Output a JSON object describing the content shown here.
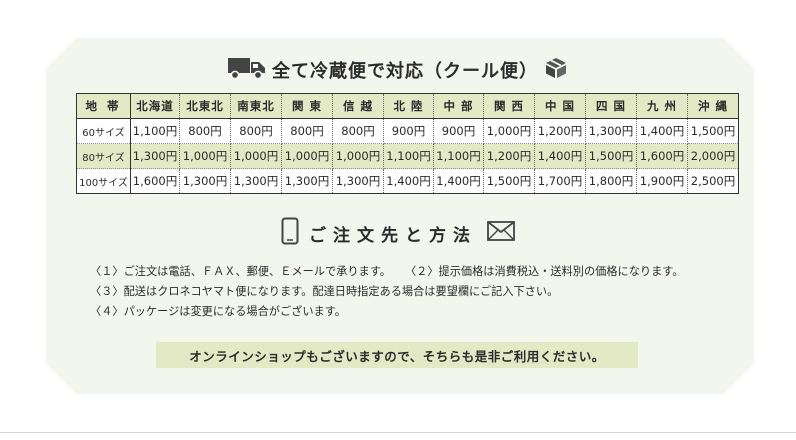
{
  "section1": {
    "title": "全て冷蔵便で対応（クール便）",
    "left_icon": "truck-icon",
    "right_icon": "box-icon"
  },
  "rates_table": {
    "header_label": "地 帯",
    "regions": [
      "北海道",
      "北東北",
      "南東北",
      "関 東",
      "信 越",
      "北 陸",
      "中 部",
      "関 西",
      "中 国",
      "四 国",
      "九 州",
      "沖 縄"
    ],
    "rows": [
      {
        "size": "60サイズ",
        "prices": [
          "1,100円",
          "800円",
          "800円",
          "800円",
          "800円",
          "900円",
          "900円",
          "1,000円",
          "1,200円",
          "1,300円",
          "1,400円",
          "1,500円"
        ]
      },
      {
        "size": "80サイズ",
        "prices": [
          "1,300円",
          "1,000円",
          "1,000円",
          "1,000円",
          "1,000円",
          "1,100円",
          "1,100円",
          "1,200円",
          "1,400円",
          "1,500円",
          "1,600円",
          "2,000円"
        ]
      },
      {
        "size": "100サイズ",
        "prices": [
          "1,600円",
          "1,300円",
          "1,300円",
          "1,300円",
          "1,300円",
          "1,400円",
          "1,400円",
          "1,500円",
          "1,700円",
          "1,800円",
          "1,900円",
          "2,500円"
        ]
      }
    ]
  },
  "section2": {
    "title": "ご注文先と方法",
    "left_icon": "smartphone-icon",
    "right_icon": "envelope-icon"
  },
  "notes": {
    "n1": "〈１〉ご注文は電話、ＦＡＸ、郵便、Ｅメールで承ります。",
    "n2": "〈２〉提示価格は消費税込・送料別の価格になります。",
    "n3": "〈３〉配送はクロネコヤマト便になります。配達日時指定ある場合は要望欄にご記入下さい。",
    "n4": "〈４〉パッケージは変更になる場合がございます。"
  },
  "banner": {
    "text": "オンラインショップもございますので、そちらも是非ご利用ください。"
  },
  "colors": {
    "panel_bg": "#f3f6ec",
    "accent_green": "#e3e8c5",
    "text": "#2b2b2b"
  }
}
